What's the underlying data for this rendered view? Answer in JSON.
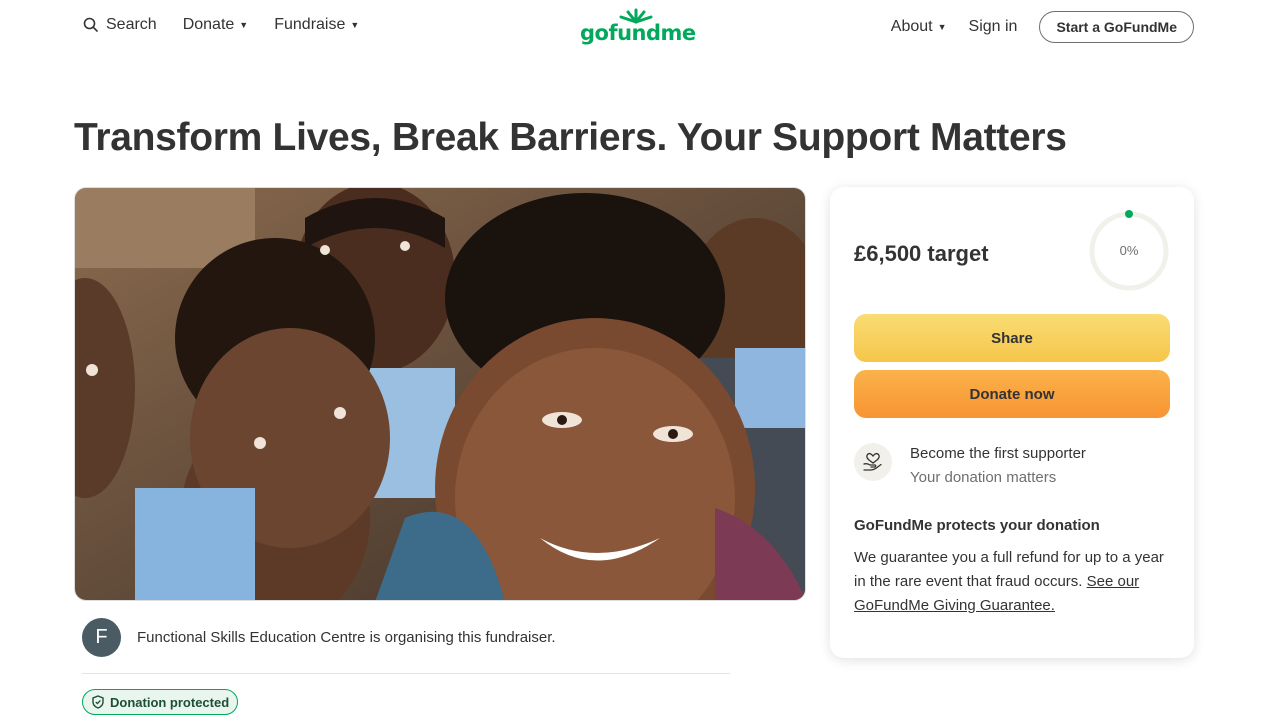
{
  "header": {
    "search_label": "Search",
    "donate_label": "Donate",
    "fundraise_label": "Fundraise",
    "logo_text": "gofundme",
    "about_label": "About",
    "signin_label": "Sign in",
    "start_label": "Start a GoFundMe"
  },
  "campaign": {
    "title": "Transform Lives, Break Barriers. Your Support Matters",
    "organizer_initial": "F",
    "organizer_text": "Functional Skills Education Centre is organising this fundraiser.",
    "badge_label": "Donation protected"
  },
  "card": {
    "target": "£6,500 target",
    "progress_label": "0%",
    "progress_value": 0,
    "share_label": "Share",
    "donate_label": "Donate now",
    "supporter_title": "Become the first supporter",
    "supporter_sub": "Your donation matters",
    "protect_title": "GoFundMe protects your donation",
    "protect_body": "We guarantee you a full refund for up to a year in the rare event that fraud occurs. ",
    "protect_link": "See our GoFundMe Giving Guarantee."
  },
  "colors": {
    "brand_green": "#02a95c",
    "share_yellow": "#f7cf5c",
    "donate_orange": "#f8a23e",
    "text_dark": "#333333"
  }
}
